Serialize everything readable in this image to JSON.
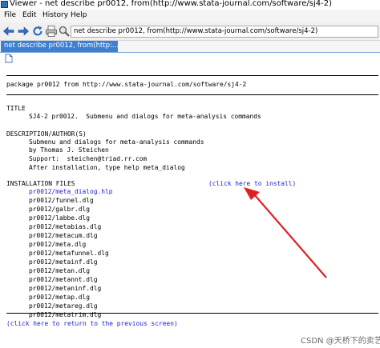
{
  "window": {
    "title": "Viewer - net describe pr0012, from(http://www.stata-journal.com/software/sj4-2)"
  },
  "menu": {
    "file": "File",
    "edit": "Edit",
    "history": "History",
    "help": "Help"
  },
  "toolbar": {
    "address": "net describe pr0012, from(http://www.stata-journal.com/software/sj4-2)"
  },
  "tab": {
    "label": "net describe pr0012, from(http:..."
  },
  "content": {
    "package_line": "package pr0012 from http://www.stata-journal.com/software/sj4-2",
    "title_heading": "TITLE",
    "title_text": "SJ4-2 pr0012.  Submenu and dialogs for meta-analysis commands",
    "desc_heading": "DESCRIPTION/AUTHOR(S)",
    "desc_lines": [
      "Submenu and dialogs for meta-analysis commands",
      "by Thomas J. Steichen",
      "Support:  steichen@triad.rr.com",
      "After installation, type help meta_dialog"
    ],
    "install_heading": "INSTALLATION FILES",
    "install_link": "(click here to install)",
    "files": [
      "pr0012/meta_dialog.hlp",
      "pr0012/funnel.dlg",
      "pr0012/galbr.dlg",
      "pr0012/labbe.dlg",
      "pr0012/metabias.dlg",
      "pr0012/metacum.dlg",
      "pr0012/meta.dlg",
      "pr0012/metafunnel.dlg",
      "pr0012/metainf.dlg",
      "pr0012/metan.dlg",
      "pr0012/metannt.dlg",
      "pr0012/metaninf.dlg",
      "pr0012/metap.dlg",
      "pr0012/metareg.dlg",
      "pr0012/metatrim.dlg"
    ],
    "return_link": "(click here to return to the previous screen)"
  },
  "watermark": "CSDN @天桥下的卖艺者",
  "colors": {
    "link": "#1a1ad8",
    "tab": "#3e7fd0",
    "arrow": "#e02020"
  }
}
